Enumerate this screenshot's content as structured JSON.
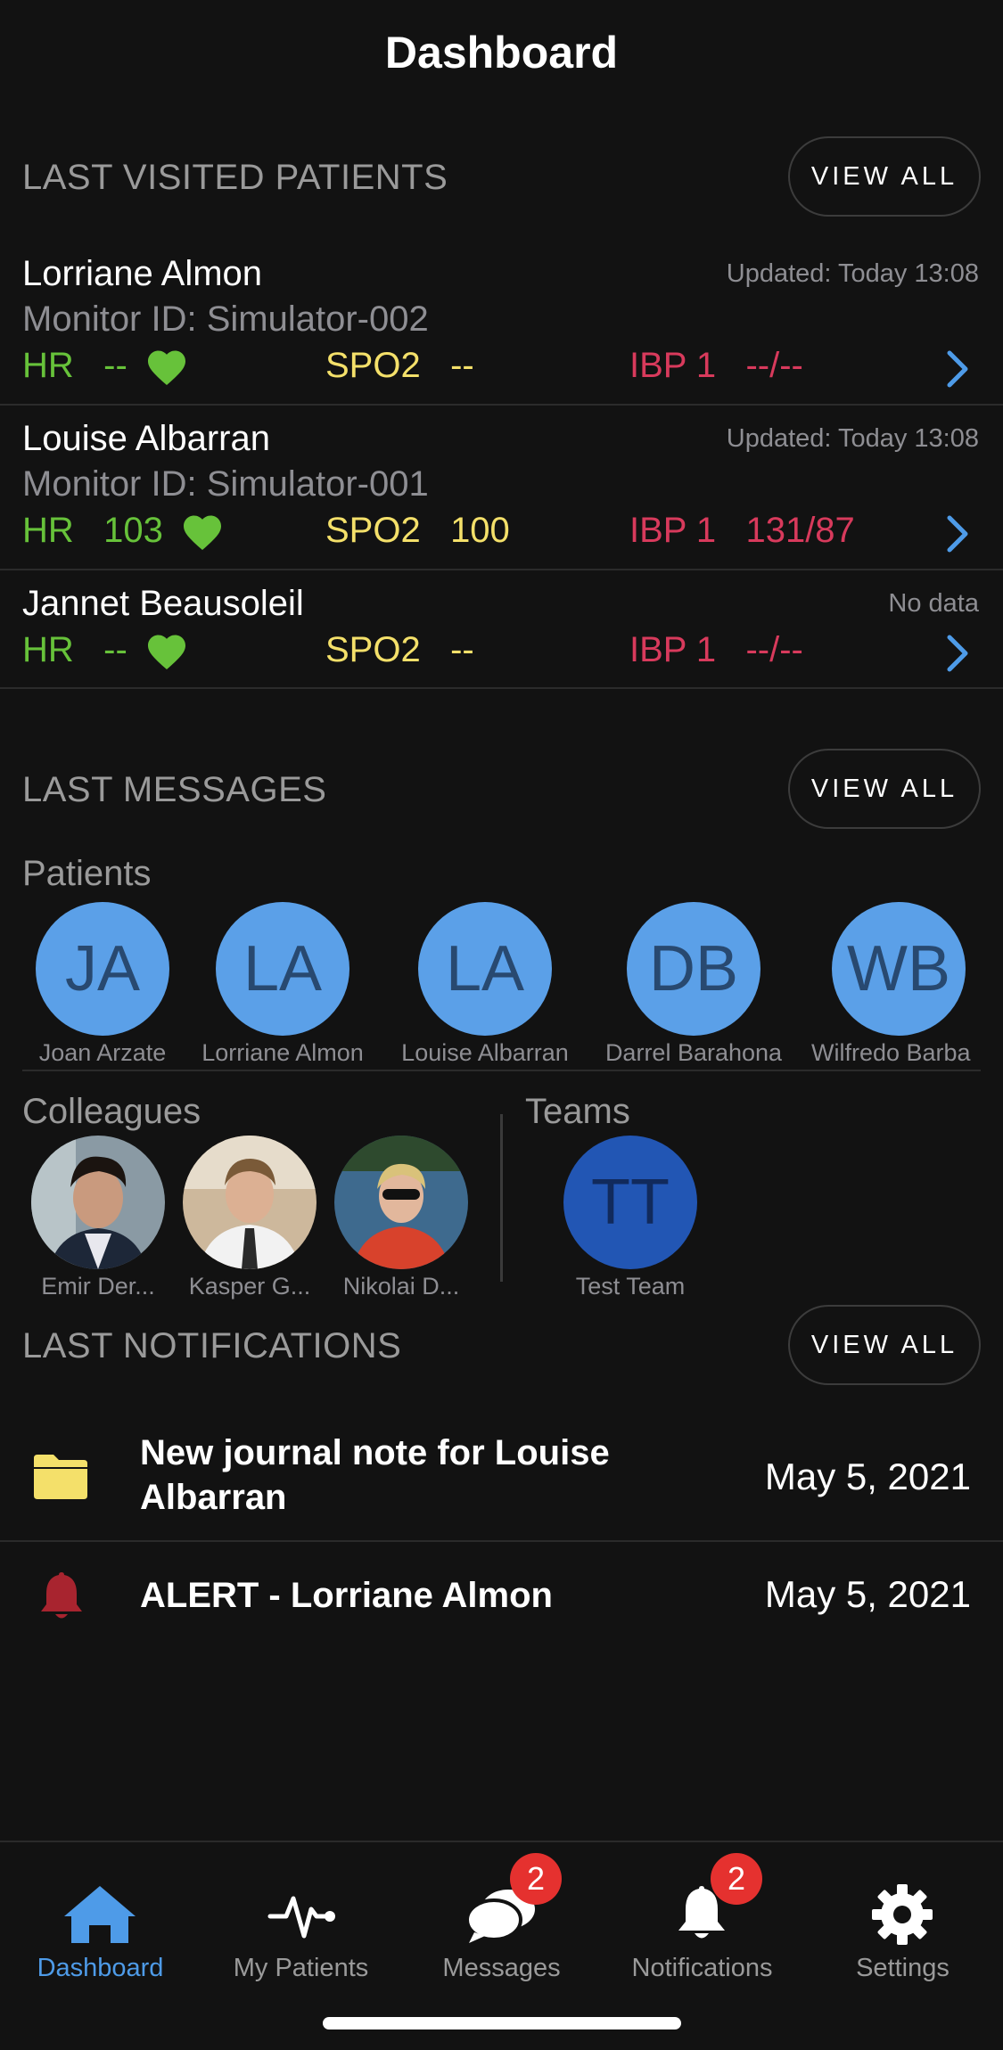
{
  "header": {
    "title": "Dashboard"
  },
  "last_visited": {
    "title": "LAST VISITED PATIENTS",
    "view_all": "VIEW ALL",
    "patients": [
      {
        "name": "Lorriane Almon",
        "updated": "Updated: Today 13:08",
        "monitor": "Monitor ID: Simulator-002",
        "hr_label": "HR",
        "hr_value": "--",
        "spo2_label": "SPO2",
        "spo2_value": "--",
        "ibp_label": "IBP 1",
        "ibp_value": "--/--"
      },
      {
        "name": "Louise Albarran",
        "updated": "Updated: Today 13:08",
        "monitor": "Monitor ID: Simulator-001",
        "hr_label": "HR",
        "hr_value": "103",
        "spo2_label": "SPO2",
        "spo2_value": "100",
        "ibp_label": "IBP 1",
        "ibp_value": "131/87"
      },
      {
        "name": "Jannet Beausoleil",
        "updated": "No data",
        "monitor": "",
        "hr_label": "HR",
        "hr_value": "--",
        "spo2_label": "SPO2",
        "spo2_value": "--",
        "ibp_label": "IBP 1",
        "ibp_value": "--/--"
      }
    ]
  },
  "last_messages": {
    "title": "LAST MESSAGES",
    "view_all": "VIEW ALL",
    "patients_label": "Patients",
    "patients": [
      {
        "initials": "JA",
        "name": "Joan Arzate"
      },
      {
        "initials": "LA",
        "name": "Lorriane Almon"
      },
      {
        "initials": "LA",
        "name": "Louise Albarran"
      },
      {
        "initials": "DB",
        "name": "Darrel Barahona"
      },
      {
        "initials": "WB",
        "name": "Wilfredo Barba"
      }
    ],
    "colleagues_label": "Colleagues",
    "colleagues": [
      {
        "name": "Emir Der..."
      },
      {
        "name": "Kasper G..."
      },
      {
        "name": "Nikolai D..."
      }
    ],
    "teams_label": "Teams",
    "teams": [
      {
        "initials": "TT",
        "name": "Test Team"
      }
    ]
  },
  "last_notifications": {
    "title": "LAST NOTIFICATIONS",
    "view_all": "VIEW ALL",
    "items": [
      {
        "icon": "folder-icon",
        "title": "New journal note for Louise Albarran",
        "date": "May 5, 2021"
      },
      {
        "icon": "bell-icon",
        "title": "ALERT - Lorriane Almon",
        "date": "May 5, 2021"
      }
    ]
  },
  "tabbar": {
    "tabs": [
      {
        "label": "Dashboard",
        "icon": "home-icon",
        "active": true
      },
      {
        "label": "My Patients",
        "icon": "pulse-icon"
      },
      {
        "label": "Messages",
        "icon": "chat-bubbles-icon",
        "badge": "2"
      },
      {
        "label": "Notifications",
        "icon": "bell-icon",
        "badge": "2"
      },
      {
        "label": "Settings",
        "icon": "gear-icon"
      }
    ]
  },
  "colors": {
    "accent": "#4e9be8",
    "hr": "#67c23a",
    "spo2": "#f4e06a",
    "ibp": "#d83a5c",
    "badge": "#e5312f",
    "avatar": "#5ba0e8",
    "team": "#2256b4"
  }
}
